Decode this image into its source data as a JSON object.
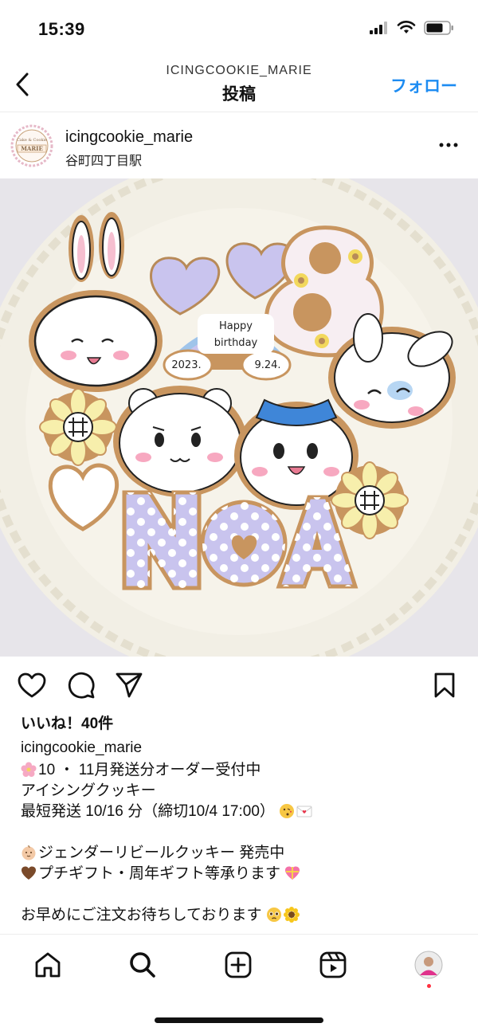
{
  "status": {
    "time": "15:39"
  },
  "header": {
    "account": "ICINGCOOKIE_MARIE",
    "title": "投稿",
    "follow_label": "フォロー"
  },
  "post": {
    "username": "icingcookie_marie",
    "location": "谷町四丁目駅",
    "avatar_text": {
      "top": "Cake & Cookie",
      "main": "MARIE"
    },
    "image_text": {
      "cake_line1": "Happy",
      "cake_line2": "birthday",
      "date_left": "2023.",
      "date_right": "9.24.",
      "name": "NOA",
      "number": "8"
    },
    "likes": "いいね！40件",
    "caption_user": "icingcookie_marie",
    "caption_lines": [
      "10 ・ 11月発送分オーダー受付中",
      "アイシングクッキー",
      "最短発送 10/16 分（締切10/4 17:00）",
      "",
      "ジェンダーリビールクッキー 発売中",
      "プチギフト・周年ギフト等承ります",
      "",
      "お早めにご注文お待ちしております"
    ]
  },
  "icons": {
    "status": [
      "signal-icon",
      "wifi-icon",
      "battery-icon"
    ],
    "actions": [
      "heart-icon",
      "comment-icon",
      "share-icon",
      "bookmark-icon"
    ],
    "tabs": [
      "home-icon",
      "search-icon",
      "create-icon",
      "reels-icon",
      "profile-avatar"
    ],
    "caption_emoji": [
      "cherry-blossom",
      "kiss-face",
      "love-letter",
      "baby-face",
      "brown-heart",
      "gift-heart",
      "pleading-face",
      "sunflower"
    ]
  },
  "colors": {
    "accent": "#1d8cf2",
    "notification": "#ff3040",
    "cookie_lavender": "#c9c4ee",
    "cookie_base": "#c8955f"
  }
}
